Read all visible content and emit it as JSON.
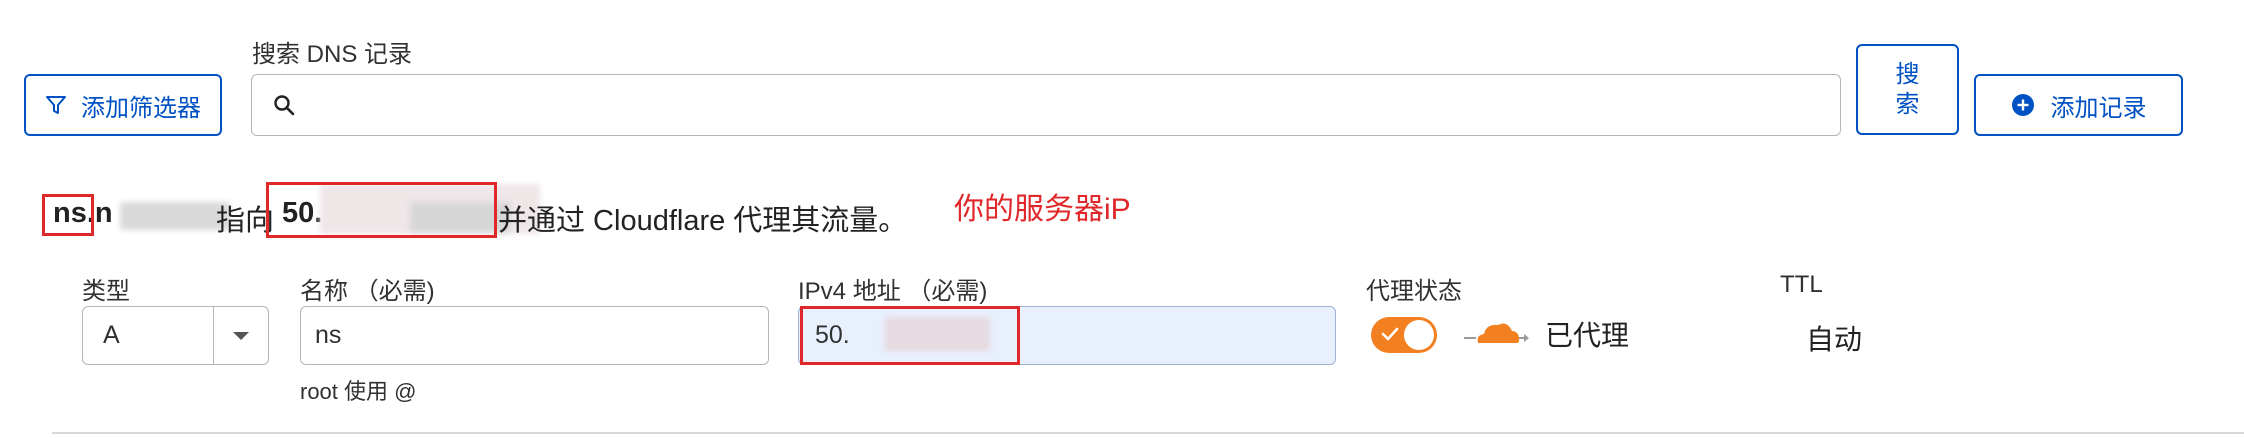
{
  "search": {
    "label": "搜索 DNS 记录",
    "filter_button": "添加筛选器",
    "search_button_line1": "搜",
    "search_button_line2": "索",
    "add_record_button": "添加记录"
  },
  "info": {
    "name_visible": "ns.n",
    "points_to": "指向",
    "ip_visible": "50.",
    "suffix": "并通过 Cloudflare 代理其流量。",
    "annotation": "你的服务器iP"
  },
  "form": {
    "type_label": "类型",
    "type_value": "A",
    "name_label": "名称 （必需)",
    "name_value": "ns",
    "name_hint": "root 使用 @",
    "ipv4_label": "IPv4 地址 （必需)",
    "ipv4_value": "50.",
    "proxy_label": "代理状态",
    "proxy_status": "已代理",
    "ttl_label": "TTL",
    "ttl_value": "自动"
  },
  "colors": {
    "accent": "#0051c3",
    "annotation_red": "#e0272a",
    "toggle_orange": "#f38020",
    "ipv4_bg": "#e8f0fe"
  },
  "icons": [
    "filter-icon",
    "search-icon",
    "plus-circle-icon",
    "chevron-down-icon",
    "check-icon",
    "cloud-proxied-icon"
  ]
}
